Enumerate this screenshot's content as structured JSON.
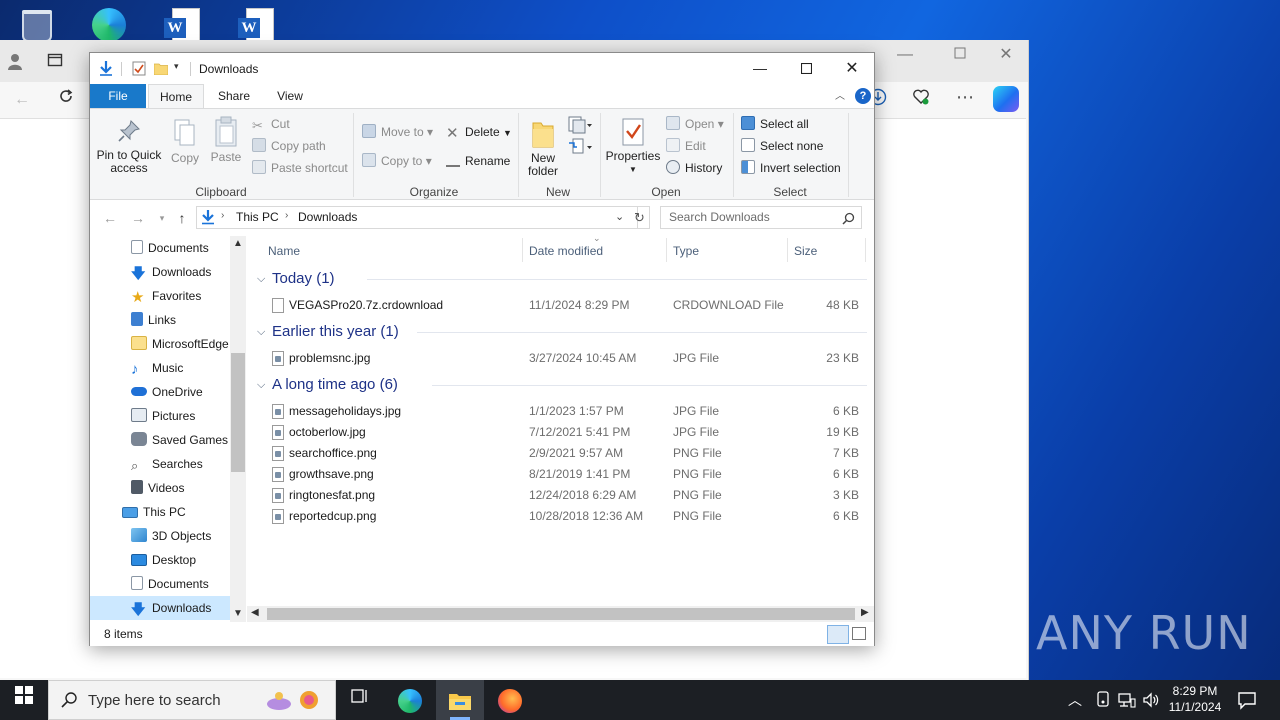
{
  "explorer": {
    "title": "Downloads",
    "tabs": {
      "file": "File",
      "home": "Home",
      "share": "Share",
      "view": "View"
    },
    "ribbon": {
      "clipboard": {
        "pin": "Pin to Quick access",
        "copy": "Copy",
        "paste": "Paste",
        "cut": "Cut",
        "copy_path": "Copy path",
        "paste_shortcut": "Paste shortcut",
        "label": "Clipboard"
      },
      "organize": {
        "move_to": "Move to",
        "copy_to": "Copy to",
        "delete": "Delete",
        "rename": "Rename",
        "label": "Organize"
      },
      "new": {
        "new_folder": "New folder",
        "label": "New"
      },
      "open": {
        "properties": "Properties",
        "open": "Open",
        "edit": "Edit",
        "history": "History",
        "label": "Open"
      },
      "select": {
        "select_all": "Select all",
        "select_none": "Select none",
        "invert": "Invert selection",
        "label": "Select"
      }
    },
    "breadcrumb": [
      "This PC",
      "Downloads"
    ],
    "search_placeholder": "Search Downloads",
    "nav_items": [
      "Documents",
      "Downloads",
      "Favorites",
      "Links",
      "MicrosoftEdge",
      "Music",
      "OneDrive",
      "Pictures",
      "Saved Games",
      "Searches",
      "Videos",
      "This PC",
      "3D Objects",
      "Desktop",
      "Documents",
      "Downloads"
    ],
    "columns": {
      "name": "Name",
      "date": "Date modified",
      "type": "Type",
      "size": "Size"
    },
    "groups": [
      {
        "label": "Today (1)",
        "files": [
          {
            "name": "VEGASPro20.7z.crdownload",
            "date": "11/1/2024 8:29 PM",
            "type": "CRDOWNLOAD File",
            "size": "48 KB"
          }
        ]
      },
      {
        "label": "Earlier this year (1)",
        "files": [
          {
            "name": "problemsnc.jpg",
            "date": "3/27/2024 10:45 AM",
            "type": "JPG File",
            "size": "23 KB"
          }
        ]
      },
      {
        "label": "A long time ago (6)",
        "files": [
          {
            "name": "messageholidays.jpg",
            "date": "1/1/2023 1:57 PM",
            "type": "JPG File",
            "size": "6 KB"
          },
          {
            "name": "octoberlow.jpg",
            "date": "7/12/2021 5:41 PM",
            "type": "JPG File",
            "size": "19 KB"
          },
          {
            "name": "searchoffice.png",
            "date": "2/9/2021 9:57 AM",
            "type": "PNG File",
            "size": "7 KB"
          },
          {
            "name": "growthsave.png",
            "date": "8/21/2019 1:41 PM",
            "type": "PNG File",
            "size": "6 KB"
          },
          {
            "name": "ringtonesfat.png",
            "date": "12/24/2018 6:29 AM",
            "type": "PNG File",
            "size": "3 KB"
          },
          {
            "name": "reportedcup.png",
            "date": "10/28/2018 12:36 AM",
            "type": "PNG File",
            "size": "6 KB"
          }
        ]
      }
    ],
    "status": "8 items"
  },
  "taskbar": {
    "search_placeholder": "Type here to search",
    "time": "8:29 PM",
    "date": "11/1/2024"
  },
  "watermark": "ANY RUN",
  "colors": {
    "accent": "#1979ca",
    "group_header": "#1e3287",
    "selection": "#cce8ff"
  }
}
